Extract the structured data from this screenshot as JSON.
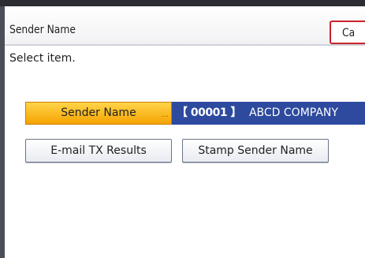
{
  "header": {
    "title": "Sender Name",
    "cancel_label": "Ca"
  },
  "prompt": "Select item.",
  "sender_row": {
    "label": "Sender Name",
    "dots": "...",
    "code": "【 00001 】",
    "company": "ABCD COMPANY"
  },
  "options": {
    "email_tx": "E-mail TX Results",
    "stamp": "Stamp Sender Name"
  },
  "colors": {
    "selected_button": "#f5a300",
    "value_panel": "#2d4a9e",
    "cancel_border": "#c8232a"
  }
}
